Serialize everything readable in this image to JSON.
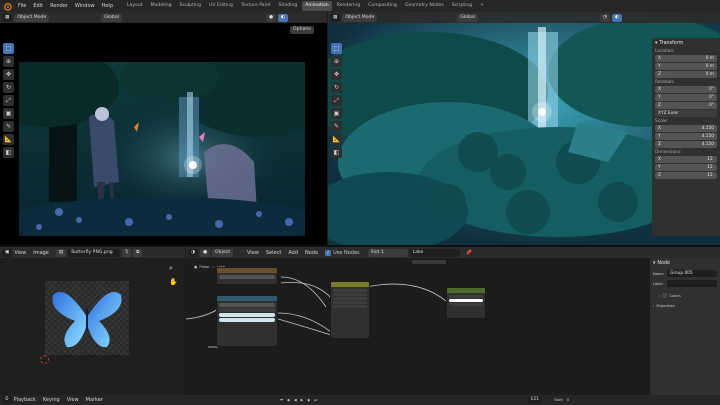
{
  "topbar": {
    "menus": [
      "File",
      "Edit",
      "Render",
      "Window",
      "Help"
    ],
    "workspaces": [
      "Layout",
      "Modeling",
      "Sculpting",
      "UV Editing",
      "Texture Paint",
      "Shading",
      "Animation",
      "Rendering",
      "Compositing",
      "Geometry Nodes",
      "Scripting"
    ],
    "active_workspace": "Animation",
    "add_tab": "+"
  },
  "left_viewport": {
    "mode": "Object Mode",
    "orientation": "Global",
    "options": "Options"
  },
  "right_viewport": {
    "mode": "Object Mode",
    "orientation": "Global"
  },
  "transform_panel": {
    "title": "Transform",
    "location_label": "Location:",
    "location": [
      {
        "axis": "X",
        "value": "0 m"
      },
      {
        "axis": "Y",
        "value": "0 m"
      },
      {
        "axis": "Z",
        "value": "0 m"
      }
    ],
    "rotation_label": "Rotation:",
    "rotation": [
      {
        "axis": "X",
        "value": "0°"
      },
      {
        "axis": "Y",
        "value": "0°"
      },
      {
        "axis": "Z",
        "value": "0°"
      }
    ],
    "rotation_mode": "XYZ Euler",
    "scale_label": "Scale:",
    "scale": [
      {
        "axis": "X",
        "value": "4.150"
      },
      {
        "axis": "Y",
        "value": "4.150"
      },
      {
        "axis": "Z",
        "value": "4.150"
      }
    ],
    "dimensions_label": "Dimensions:",
    "dimensions": [
      {
        "axis": "X",
        "value": "12."
      },
      {
        "axis": "Y",
        "value": "12."
      },
      {
        "axis": "Z",
        "value": "12."
      }
    ]
  },
  "image_editor": {
    "menus": [
      "View",
      "Image"
    ],
    "image_name": "Butterfly PNG.png",
    "users": "5"
  },
  "node_editor": {
    "type": "Object",
    "menus": [
      "View",
      "Select",
      "Add",
      "Node"
    ],
    "use_nodes": "Use Nodes",
    "slot": "Slot 1",
    "material": "Lake",
    "breadcrumb_obj": "Plane",
    "breadcrumb_mat": "Lake"
  },
  "node_sidebar": {
    "title": "Node",
    "name_label": "Name",
    "name_value": "Group.005",
    "label_label": "Label",
    "label_value": "",
    "colors": "Colors",
    "properties": "Properties"
  },
  "timeline": {
    "menus": [
      "Playback",
      "Keying",
      "View",
      "Marker"
    ],
    "frame": "121",
    "start_label": "Start",
    "start_value": "0"
  },
  "colors": {
    "accent": "#4772b3",
    "active_tab": "#4d4d4d",
    "node_green": "#4f6b2c",
    "node_teal": "#2f5b6e"
  }
}
